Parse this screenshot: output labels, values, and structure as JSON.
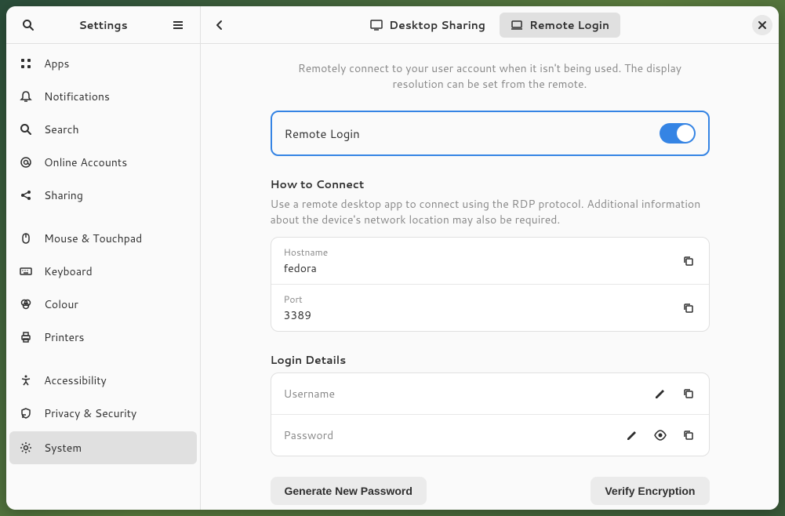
{
  "sidebar": {
    "title": "Settings",
    "items": [
      {
        "label": "Apps",
        "icon": "apps"
      },
      {
        "label": "Notifications",
        "icon": "bell"
      },
      {
        "label": "Search",
        "icon": "search"
      },
      {
        "label": "Online Accounts",
        "icon": "at"
      },
      {
        "label": "Sharing",
        "icon": "share"
      },
      {
        "label": "Mouse & Touchpad",
        "icon": "mouse",
        "sep_before": true
      },
      {
        "label": "Keyboard",
        "icon": "keyboard"
      },
      {
        "label": "Colour",
        "icon": "color"
      },
      {
        "label": "Printers",
        "icon": "printer"
      },
      {
        "label": "Accessibility",
        "icon": "accessibility",
        "sep_before": true
      },
      {
        "label": "Privacy & Security",
        "icon": "privacy"
      },
      {
        "label": "System",
        "icon": "gear",
        "active": true
      }
    ]
  },
  "header": {
    "tabs": [
      {
        "label": "Desktop Sharing",
        "active": false
      },
      {
        "label": "Remote Login",
        "active": true
      }
    ]
  },
  "main": {
    "description": "Remotely connect to your user account when it isn't being used. The display resolution can be set from the remote.",
    "toggle": {
      "label": "Remote Login",
      "on": true
    },
    "how_to_connect": {
      "title": "How to Connect",
      "description": "Use a remote desktop app to connect using the RDP protocol. Additional information about the device's network location may also be required.",
      "hostname_label": "Hostname",
      "hostname_value": "fedora",
      "port_label": "Port",
      "port_value": "3389"
    },
    "login_details": {
      "title": "Login Details",
      "username_label": "Username",
      "password_label": "Password"
    },
    "buttons": {
      "generate": "Generate New Password",
      "verify": "Verify Encryption"
    }
  }
}
